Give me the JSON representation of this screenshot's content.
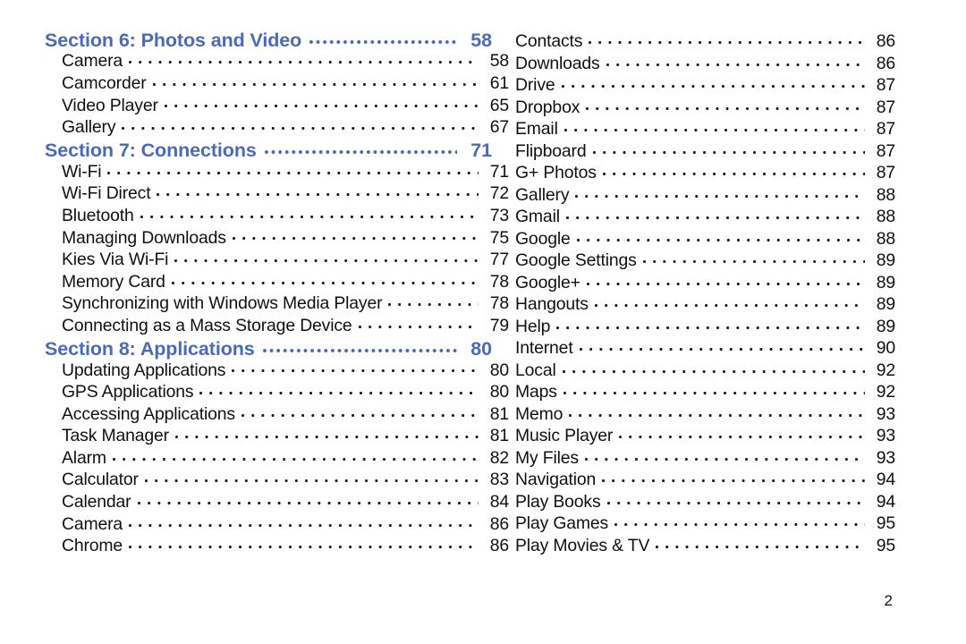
{
  "document": {
    "type": "table-of-contents",
    "page_number": "2",
    "accent_color": "#4a6cb3",
    "text_color": "#111111"
  },
  "left_column": {
    "rows": [
      {
        "kind": "section",
        "label": "Section 6:  Photos and Video",
        "page": "58"
      },
      {
        "kind": "entry",
        "label": "Camera",
        "page": "58"
      },
      {
        "kind": "entry",
        "label": "Camcorder",
        "page": "61"
      },
      {
        "kind": "entry",
        "label": "Video Player",
        "page": "65"
      },
      {
        "kind": "entry",
        "label": "Gallery",
        "page": "67"
      },
      {
        "kind": "section",
        "label": "Section 7:  Connections",
        "page": "71"
      },
      {
        "kind": "entry",
        "label": "Wi-Fi",
        "page": "71"
      },
      {
        "kind": "entry",
        "label": "Wi-Fi Direct",
        "page": "72"
      },
      {
        "kind": "entry",
        "label": "Bluetooth",
        "page": "73"
      },
      {
        "kind": "entry",
        "label": "Managing Downloads",
        "page": "75"
      },
      {
        "kind": "entry",
        "label": "Kies Via Wi-Fi",
        "page": "77"
      },
      {
        "kind": "entry",
        "label": "Memory Card",
        "page": "78"
      },
      {
        "kind": "entry",
        "label": "Synchronizing with Windows Media Player",
        "page": "78"
      },
      {
        "kind": "entry",
        "label": "Connecting as a Mass Storage Device",
        "page": "79"
      },
      {
        "kind": "section",
        "label": "Section 8:  Applications",
        "page": "80"
      },
      {
        "kind": "entry",
        "label": "Updating Applications",
        "page": "80"
      },
      {
        "kind": "entry",
        "label": "GPS Applications",
        "page": "80"
      },
      {
        "kind": "entry",
        "label": "Accessing Applications",
        "page": "81"
      },
      {
        "kind": "entry",
        "label": "Task Manager",
        "page": "81"
      },
      {
        "kind": "entry",
        "label": "Alarm",
        "page": "82"
      },
      {
        "kind": "entry",
        "label": "Calculator",
        "page": "83"
      },
      {
        "kind": "entry",
        "label": "Calendar",
        "page": "84"
      },
      {
        "kind": "entry",
        "label": "Camera",
        "page": "86"
      },
      {
        "kind": "entry",
        "label": "Chrome",
        "page": "86"
      }
    ]
  },
  "right_column": {
    "rows": [
      {
        "kind": "entry",
        "label": "Contacts",
        "page": "86"
      },
      {
        "kind": "entry",
        "label": "Downloads",
        "page": "86"
      },
      {
        "kind": "entry",
        "label": "Drive",
        "page": "87"
      },
      {
        "kind": "entry",
        "label": "Dropbox",
        "page": "87"
      },
      {
        "kind": "entry",
        "label": "Email",
        "page": "87"
      },
      {
        "kind": "entry",
        "label": "Flipboard",
        "page": "87"
      },
      {
        "kind": "entry",
        "label": "G+ Photos",
        "page": "87"
      },
      {
        "kind": "entry",
        "label": "Gallery",
        "page": "88"
      },
      {
        "kind": "entry",
        "label": "Gmail",
        "page": "88"
      },
      {
        "kind": "entry",
        "label": "Google",
        "page": "88"
      },
      {
        "kind": "entry",
        "label": "Google Settings",
        "page": "89"
      },
      {
        "kind": "entry",
        "label": "Google+",
        "page": "89"
      },
      {
        "kind": "entry",
        "label": "Hangouts",
        "page": "89"
      },
      {
        "kind": "entry",
        "label": "Help",
        "page": "89"
      },
      {
        "kind": "entry",
        "label": "Internet",
        "page": "90"
      },
      {
        "kind": "entry",
        "label": "Local",
        "page": "92"
      },
      {
        "kind": "entry",
        "label": "Maps",
        "page": "92"
      },
      {
        "kind": "entry",
        "label": "Memo",
        "page": "93"
      },
      {
        "kind": "entry",
        "label": "Music Player",
        "page": "93"
      },
      {
        "kind": "entry",
        "label": "My Files",
        "page": "93"
      },
      {
        "kind": "entry",
        "label": "Navigation",
        "page": "94"
      },
      {
        "kind": "entry",
        "label": "Play Books",
        "page": "94"
      },
      {
        "kind": "entry",
        "label": "Play Games",
        "page": "95"
      },
      {
        "kind": "entry",
        "label": "Play Movies & TV",
        "page": "95"
      }
    ]
  }
}
